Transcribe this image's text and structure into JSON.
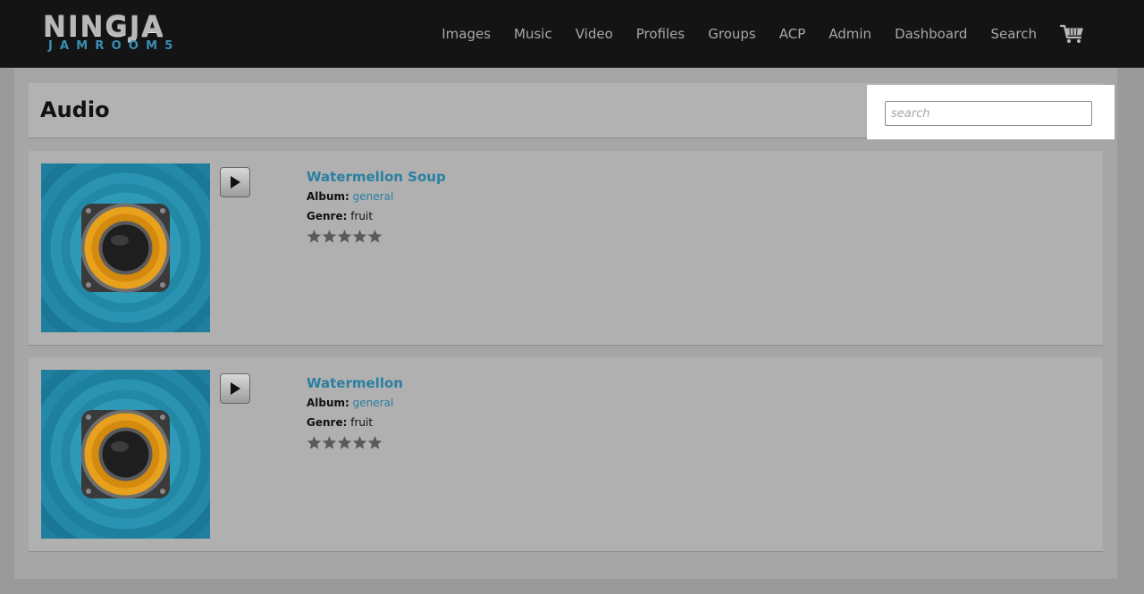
{
  "logo": {
    "top": "NINGJA",
    "bottom": "JAMROOM5"
  },
  "nav": {
    "items": [
      "Images",
      "Music",
      "Video",
      "Profiles",
      "Groups",
      "ACP",
      "Admin",
      "Dashboard",
      "Search"
    ],
    "cart_icon": "cart-icon"
  },
  "page": {
    "title": "Audio"
  },
  "search": {
    "placeholder": "search",
    "value": ""
  },
  "labels": {
    "album": "Album:",
    "genre": "Genre:"
  },
  "items": [
    {
      "title": "Watermellon Soup",
      "album": "general",
      "genre": "fruit",
      "rating_stars": 5
    },
    {
      "title": "Watermellon",
      "album": "general",
      "genre": "fruit",
      "rating_stars": 5
    }
  ],
  "colors": {
    "accent": "#2a7fa2",
    "header_bg": "#141414",
    "nav_text": "#a8a8a8"
  }
}
